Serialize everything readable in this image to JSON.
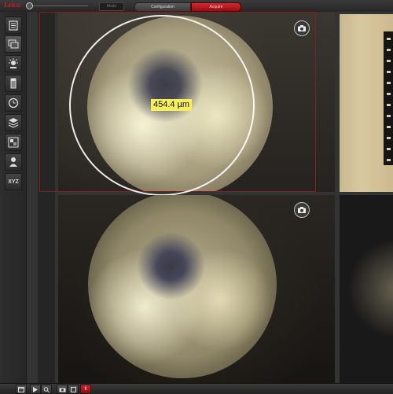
{
  "app": {
    "logo_text": "Leica",
    "mode_select": "Mode",
    "tabs": [
      {
        "label": "Configuration",
        "active": false
      },
      {
        "label": "Acquire",
        "active": true
      }
    ],
    "accent_color": "#c8202b"
  },
  "sidebar": {
    "items": [
      {
        "icon": "document-list-icon"
      },
      {
        "icon": "image-gallery-icon"
      },
      {
        "icon": "illumination-icon"
      },
      {
        "icon": "z-stack-icon"
      },
      {
        "icon": "timer-icon"
      },
      {
        "icon": "layers-icon"
      },
      {
        "icon": "image-processing-icon"
      },
      {
        "icon": "user-icon"
      },
      {
        "icon": "xyz-stage-icon",
        "label": "XYZ"
      }
    ]
  },
  "viewer": {
    "measurement": {
      "value": "454.4 µm"
    }
  },
  "bottombar": {
    "buttons": [
      {
        "icon": "window-icon"
      },
      {
        "icon": "play-icon"
      },
      {
        "icon": "loop-icon"
      },
      {
        "icon": "camera-icon"
      },
      {
        "icon": "settings-icon"
      },
      {
        "icon": "info-icon",
        "label": "i"
      }
    ]
  }
}
